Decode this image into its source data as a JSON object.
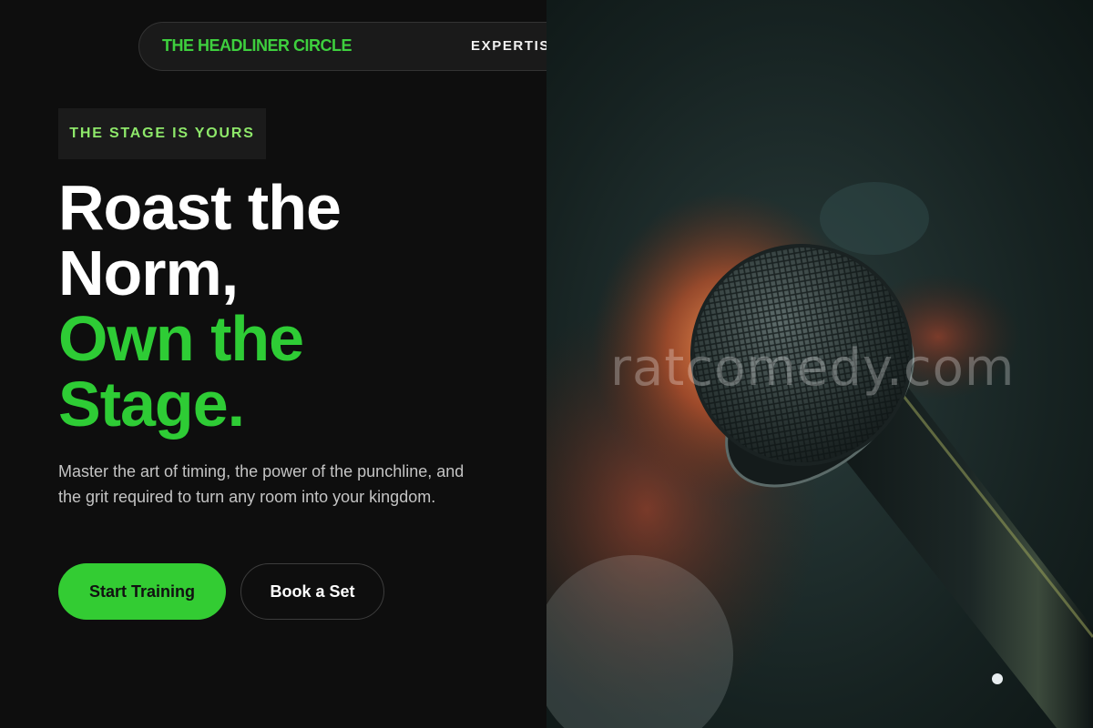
{
  "nav": {
    "brand": "THE HEADLINER CIRCLE",
    "links": [
      "EXPERTISE"
    ]
  },
  "hero": {
    "eyebrow": "THE STAGE IS YOURS",
    "headline_white": [
      "Roast the",
      "Norm,"
    ],
    "headline_green": [
      "Own the",
      "Stage."
    ],
    "subcopy": "Master the art of timing, the power of the punchline, and the grit required to turn any room into your kingdom.",
    "primary_cta": "Start Training",
    "secondary_cta": "Book a Set"
  },
  "photo": {
    "subject": "stage microphone",
    "watermark": "ratcomedy.com"
  },
  "colors": {
    "accent": "#33cc33",
    "eyebrow_text": "#8ee86a",
    "background": "#0e0e0e"
  }
}
